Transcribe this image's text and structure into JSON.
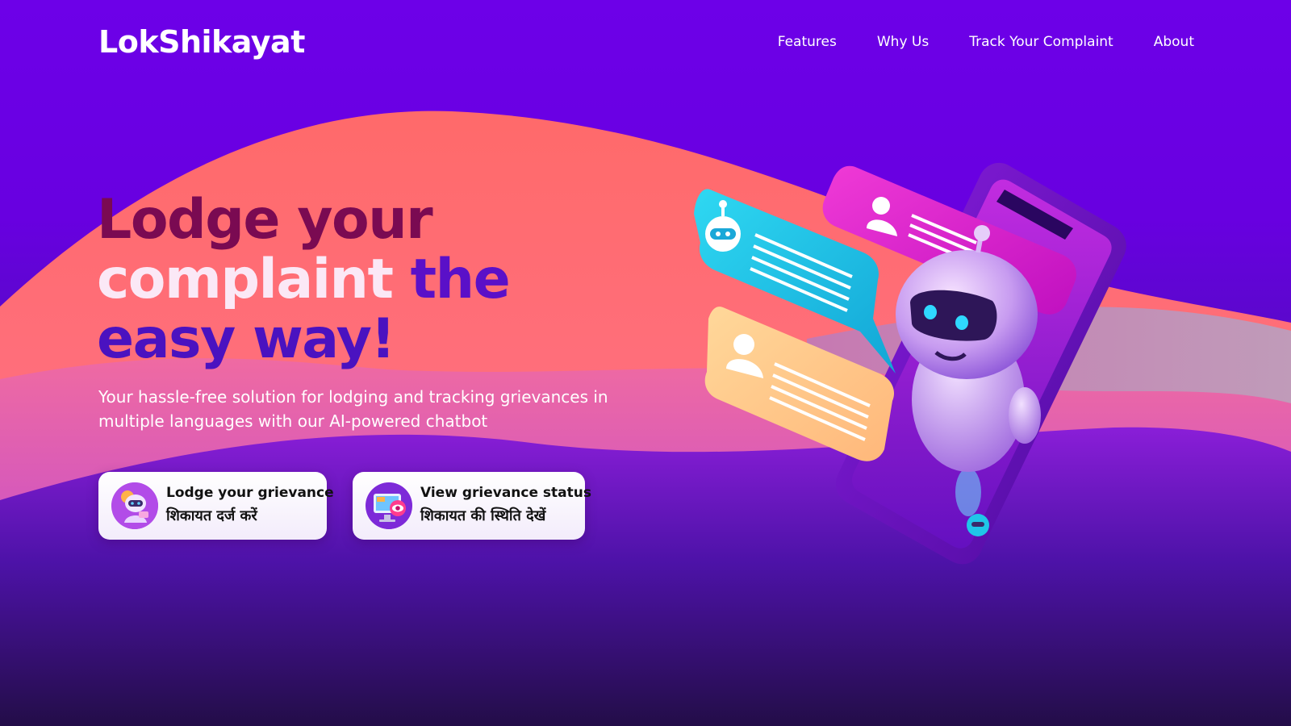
{
  "header": {
    "logo": "LokShikayat",
    "nav": [
      "Features",
      "Why Us",
      "Track Your Complaint",
      "About"
    ]
  },
  "hero": {
    "title_parts": {
      "line1": "Lodge your",
      "line2_a": "complaint",
      "line2_b": " the",
      "line3_a": "easy",
      "line3_b": " way!"
    },
    "subtitle": "Your hassle-free solution for lodging and tracking grievances in multiple languages with our AI-powered chatbot"
  },
  "cta": {
    "lodge": {
      "label_en": "Lodge your grievance",
      "label_hi": "शिकायत दर्ज करें",
      "icon": "robot-avatar-icon"
    },
    "view": {
      "label_en": "View grievance status",
      "label_hi": "शिकायत की स्थिति देखें",
      "icon": "monitor-eye-icon"
    }
  },
  "colors": {
    "background": "#6d00e8",
    "wave_coral": "#ff6f73",
    "wave_pink": "#d85ac8",
    "accent_cyan": "#1fc6e8",
    "accent_magenta": "#f01ccf",
    "accent_peach": "#ffc98a",
    "dark_footer": "#230d48"
  }
}
